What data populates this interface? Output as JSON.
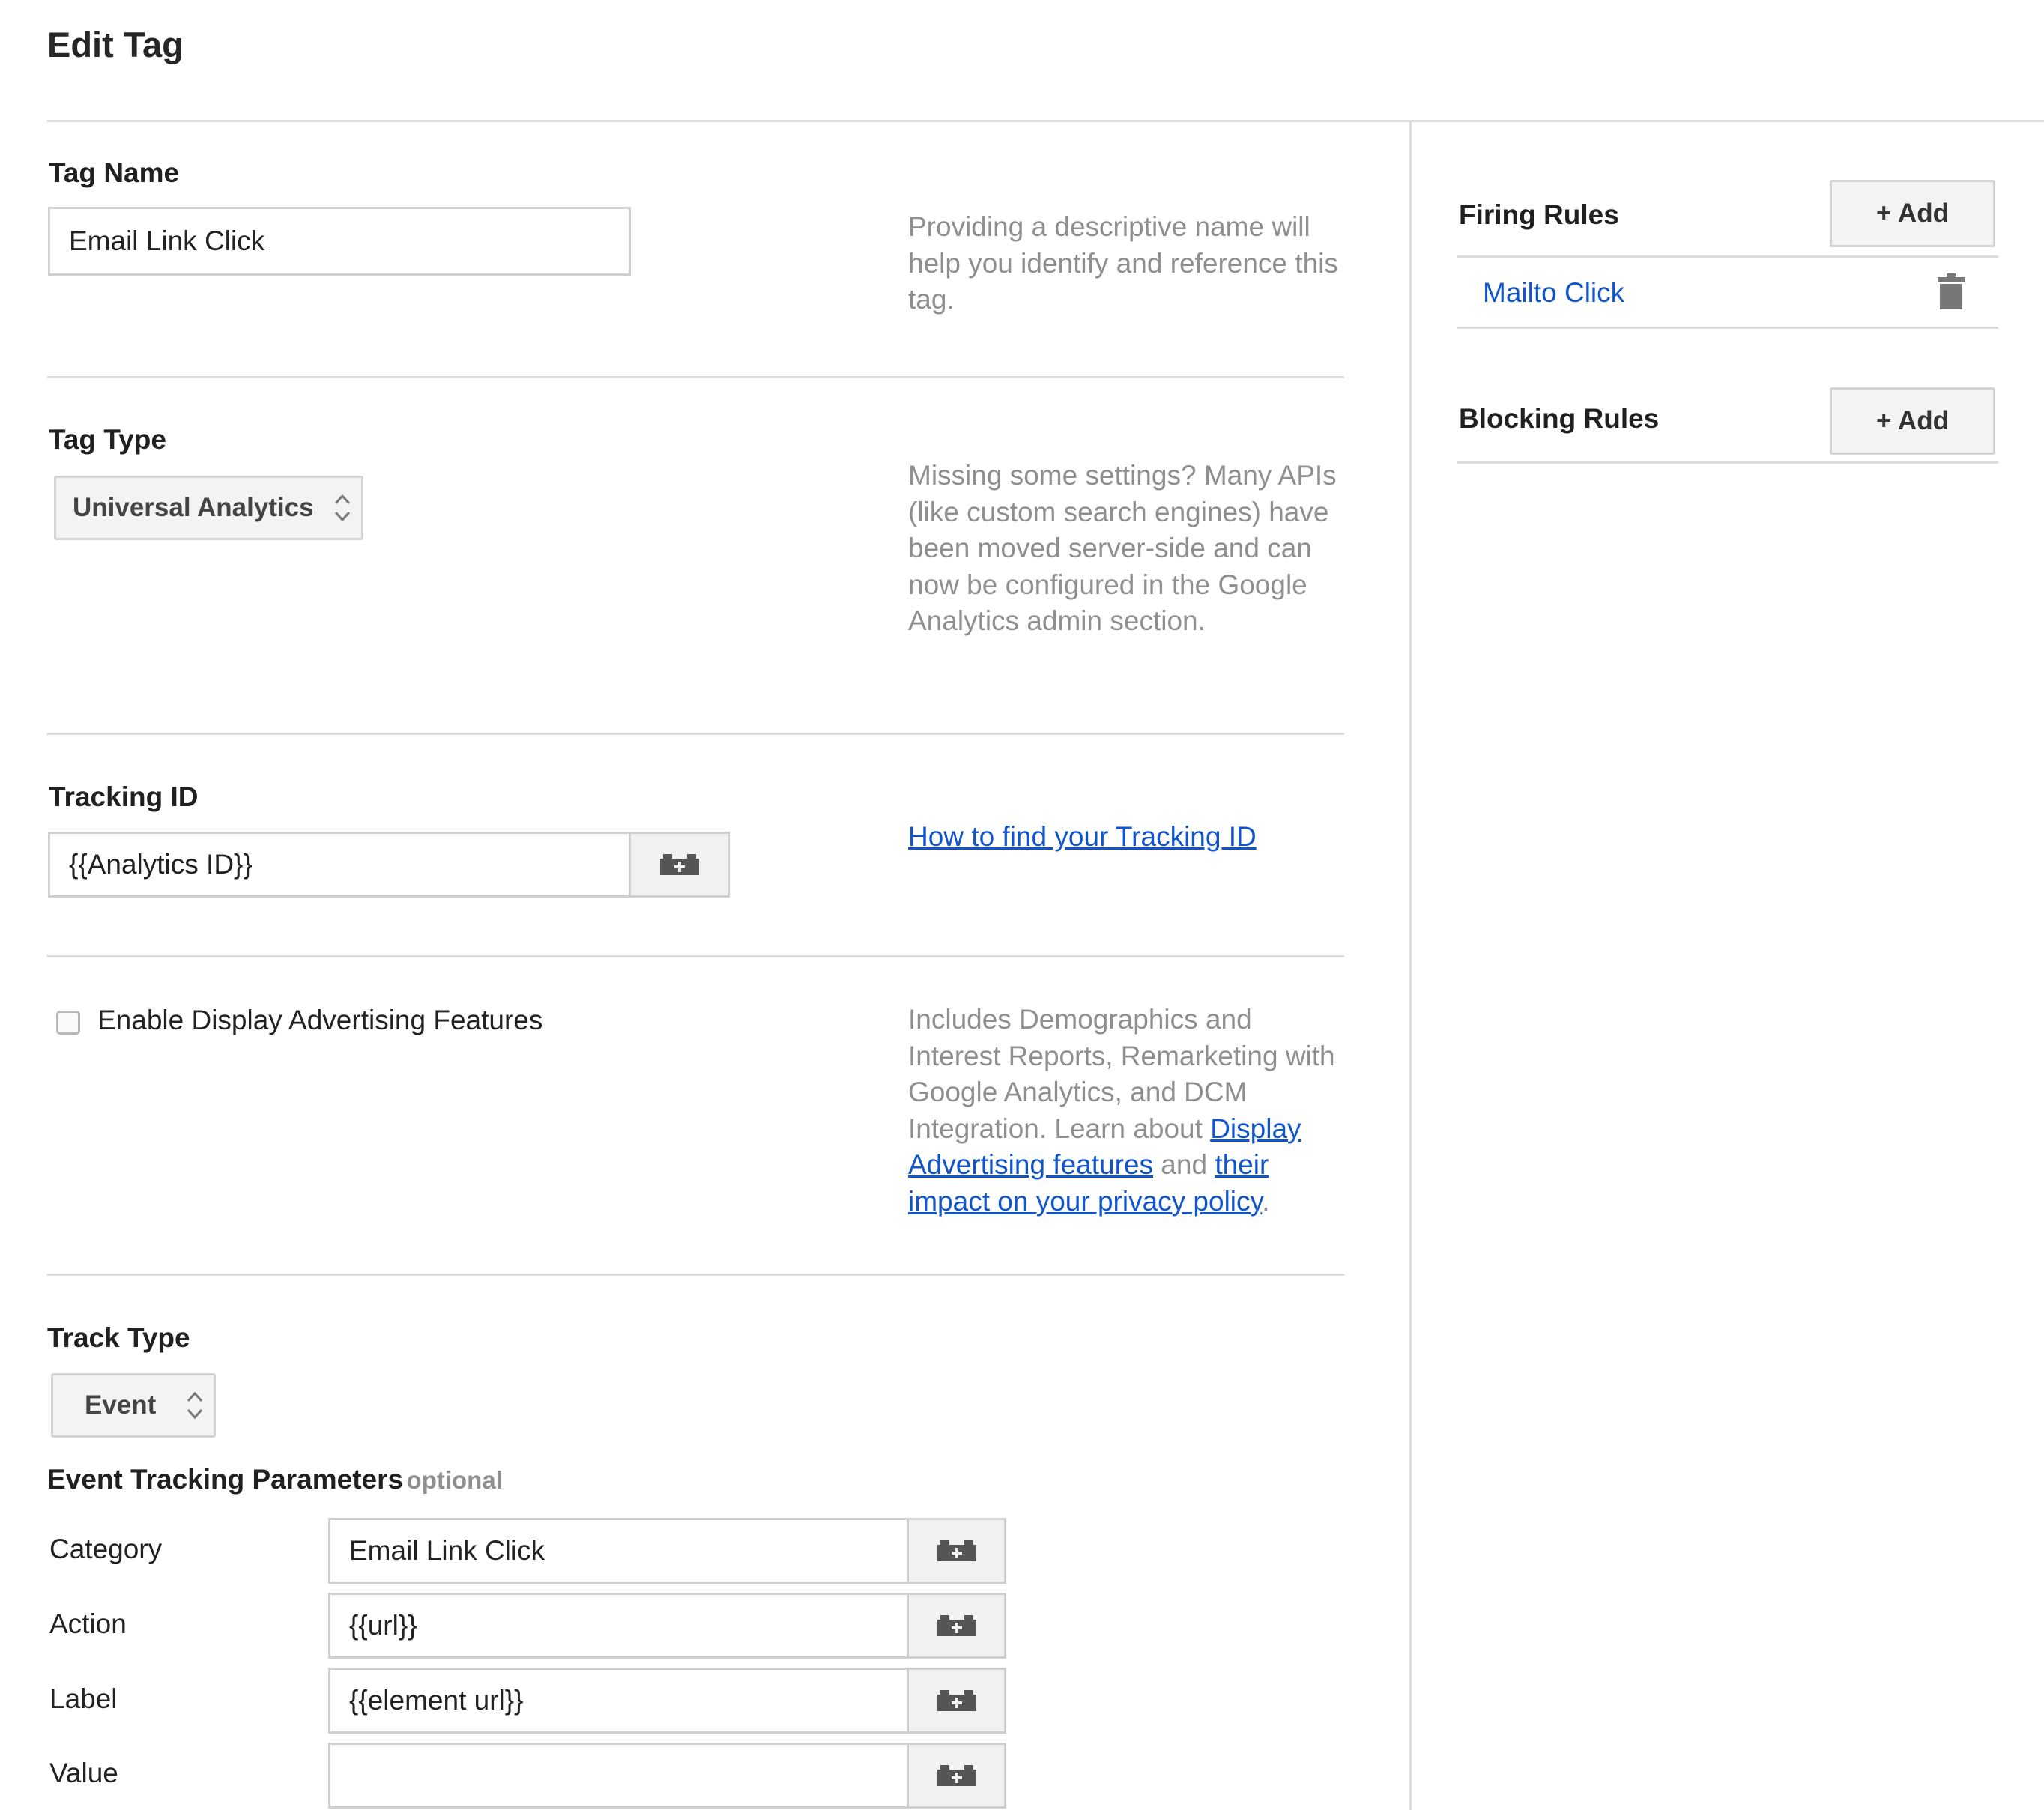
{
  "page": {
    "title": "Edit Tag"
  },
  "tag_name": {
    "label": "Tag Name",
    "value": "Email Link Click",
    "help": "Providing a descriptive name will help you identify and reference this tag."
  },
  "tag_type": {
    "label": "Tag Type",
    "selected": "Universal Analytics",
    "help": "Missing some settings? Many APIs (like custom search engines) have been moved server-side and can now be configured in the Google Analytics admin section."
  },
  "tracking_id": {
    "label": "Tracking ID",
    "value": "{{Analytics ID}}",
    "help_link": "How to find your Tracking ID"
  },
  "display_advertising": {
    "checkbox_label": "Enable Display Advertising Features",
    "checked": false,
    "help_prefix": "Includes Demographics and Interest Reports, Remarketing with Google Analytics, and DCM Integration. Learn about ",
    "link1": "Display Advertising features",
    "help_mid": " and ",
    "link2": "their impact on your privacy policy",
    "help_suffix": "."
  },
  "track_type": {
    "label": "Track Type",
    "selected": "Event"
  },
  "event_params": {
    "heading": "Event Tracking Parameters",
    "optional": "optional",
    "rows": [
      {
        "label": "Category",
        "value": "Email Link Click"
      },
      {
        "label": "Action",
        "value": "{{url}}"
      },
      {
        "label": "Label",
        "value": "{{element url}}"
      },
      {
        "label": "Value",
        "value": ""
      }
    ]
  },
  "firing_rules": {
    "label": "Firing Rules",
    "add_label": "+ Add",
    "items": [
      {
        "name": "Mailto Click"
      }
    ]
  },
  "blocking_rules": {
    "label": "Blocking Rules",
    "add_label": "+ Add"
  },
  "icons": {
    "variable": "variable-picker-icon",
    "delete": "trash-icon",
    "select": "up-down-arrows-icon"
  },
  "colors": {
    "link": "#1155cc",
    "help_text": "#8f8f8f",
    "divider": "#dcdcdc"
  }
}
